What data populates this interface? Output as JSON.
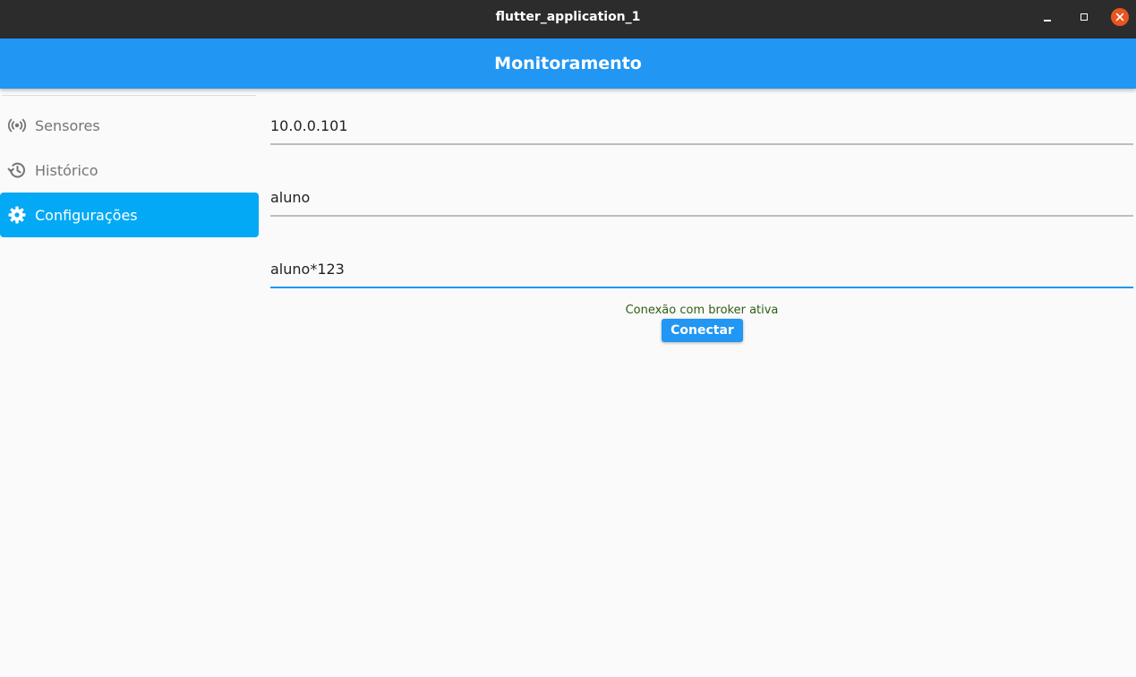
{
  "window": {
    "title": "flutter_application_1",
    "close_color": "#e95420"
  },
  "appbar": {
    "title": "Monitoramento",
    "color": "#2196f3"
  },
  "sidebar": {
    "items": [
      {
        "label": "Sensores",
        "icon": "sensors-icon",
        "active": false
      },
      {
        "label": "Histórico",
        "icon": "history-icon",
        "active": false
      },
      {
        "label": "Configurações",
        "icon": "settings-gear-icon",
        "active": true
      }
    ],
    "active_color": "#03a9f4"
  },
  "form": {
    "broker_address": "10.0.0.101",
    "username": "aluno",
    "password": "aluno*123"
  },
  "status": {
    "message": "Conexão com broker ativa",
    "color": "#2e5f14"
  },
  "connect_button": {
    "label": "Conectar"
  }
}
